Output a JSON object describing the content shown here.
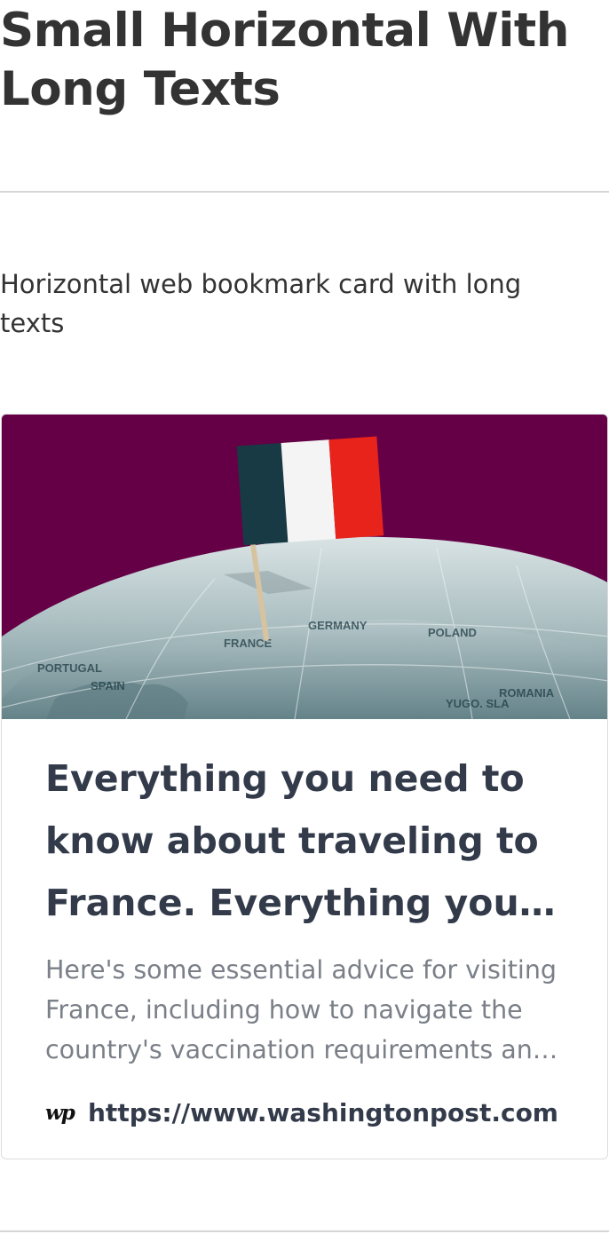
{
  "page": {
    "title": "Small Horizontal With Long Texts",
    "description": "Horizontal web bookmark card with long texts"
  },
  "bookmark_card": {
    "image_alt": "Globe with a French flag pinned on France",
    "image_icon": "globe-with-french-flag",
    "title": "Everything you need to know about traveling to France. Everything you need to know about traveling to France.",
    "excerpt": "Here's some essential advice for visiting France, including how to navigate the country's vaccination requirements and restrictions.",
    "publisher_icon": "wp",
    "url": "https://www.washingtonpost.com"
  },
  "colors": {
    "image_background": "#650047",
    "title_text": "#333b4b",
    "excerpt_text": "#7a7f88",
    "divider": "#d6d6d6"
  }
}
